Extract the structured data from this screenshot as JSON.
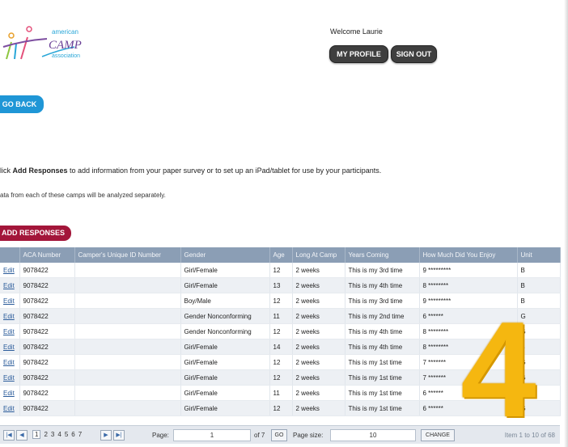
{
  "logo": {
    "line1": "american",
    "line2": "CAMP",
    "line3": "association"
  },
  "header": {
    "welcome": "Welcome Laurie",
    "my_profile": "MY PROFILE",
    "sign_out": "SIGN OUT"
  },
  "go_back": "GO BACK",
  "instructions": {
    "pre": "lick ",
    "bold": "Add Responses",
    "post": " to add information from your paper survey or to set up an iPad/tablet for use by your participants."
  },
  "note": "ata from each of these camps will be analyzed separately.",
  "add_responses": "ADD RESPONSES",
  "table": {
    "columns": [
      "",
      "ACA Number",
      "Camper's Unique ID Number",
      "Gender",
      "Age",
      "Long At Camp",
      "Years Coming",
      "How Much Did You Enjoy",
      "Unit"
    ],
    "rows": [
      [
        "Edit",
        "9078422",
        "",
        "Girl/Female",
        "12",
        "2 weeks",
        "This is my 3rd time",
        "9 *********",
        "B"
      ],
      [
        "Edit",
        "9078422",
        "",
        "Girl/Female",
        "13",
        "2 weeks",
        "This is my 4th time",
        "8 ********",
        "B"
      ],
      [
        "Edit",
        "9078422",
        "",
        "Boy/Male",
        "12",
        "2 weeks",
        "This is my 3rd time",
        "9 *********",
        "B"
      ],
      [
        "Edit",
        "9078422",
        "",
        "Gender Nonconforming",
        "11",
        "2 weeks",
        "This is my 2nd time",
        "6 ******",
        "G"
      ],
      [
        "Edit",
        "9078422",
        "",
        "Gender Nonconforming",
        "12",
        "2 weeks",
        "This is my 4th time",
        "8 ********",
        "G"
      ],
      [
        "Edit",
        "9078422",
        "",
        "Girl/Female",
        "14",
        "2 weeks",
        "This is my 4th time",
        "8 ********",
        "B"
      ],
      [
        "Edit",
        "9078422",
        "",
        "Girl/Female",
        "12",
        "2 weeks",
        "This is my 1st time",
        "7 *******",
        "G"
      ],
      [
        "Edit",
        "9078422",
        "",
        "Girl/Female",
        "12",
        "2 weeks",
        "This is my 1st time",
        "7 *******",
        "G"
      ],
      [
        "Edit",
        "9078422",
        "",
        "Girl/Female",
        "11",
        "2 weeks",
        "This is my 1st time",
        "6 ******",
        "G"
      ],
      [
        "Edit",
        "9078422",
        "",
        "Girl/Female",
        "12",
        "2 weeks",
        "This is my 1st time",
        "6 ******",
        "G"
      ]
    ]
  },
  "pager": {
    "pages": [
      "1",
      "2",
      "3",
      "4",
      "5",
      "6",
      "7"
    ],
    "page_label": "Page:",
    "page_value": "1",
    "of_label": "of 7",
    "go": "GO",
    "size_label": "Page size:",
    "size_value": "10",
    "change": "CHANGE",
    "info": "Item 1 to 10 of 68"
  },
  "annotation": "4",
  "colors": {
    "go_back": "#1f96d6",
    "add_responses": "#a3163a",
    "header_bg": "#8b9eb5",
    "annotation": "#f5b710"
  }
}
